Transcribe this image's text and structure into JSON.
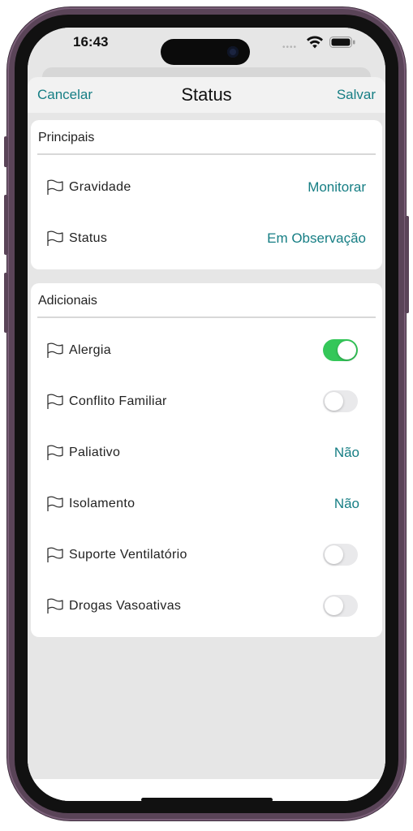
{
  "status_bar": {
    "time": "16:43",
    "signal_dots": "••••"
  },
  "nav": {
    "cancel_label": "Cancelar",
    "title": "Status",
    "save_label": "Salvar"
  },
  "principais": {
    "header": "Principais",
    "rows": [
      {
        "label": "Gravidade",
        "value": "Monitorar"
      },
      {
        "label": "Status",
        "value": "Em Observação"
      }
    ]
  },
  "adicionais": {
    "header": "Adicionais",
    "rows": [
      {
        "label": "Alergia",
        "control": "toggle",
        "on": true
      },
      {
        "label": "Conflito Familiar",
        "control": "toggle",
        "on": false
      },
      {
        "label": "Paliativo",
        "control": "value",
        "value": "Não"
      },
      {
        "label": "Isolamento",
        "control": "value",
        "value": "Não"
      },
      {
        "label": "Suporte Ventilatório",
        "control": "toggle",
        "on": false
      },
      {
        "label": "Drogas Vasoativas",
        "control": "toggle",
        "on": false
      }
    ]
  },
  "colors": {
    "accent": "#167e84",
    "toggle_on": "#34c759",
    "toggle_off": "#e9e9eb",
    "background": "#e6e6e6",
    "phone_frame": "#5a4458"
  },
  "icons": {
    "row_icon": "flag-icon",
    "wifi": "wifi-icon",
    "battery": "battery-icon"
  }
}
